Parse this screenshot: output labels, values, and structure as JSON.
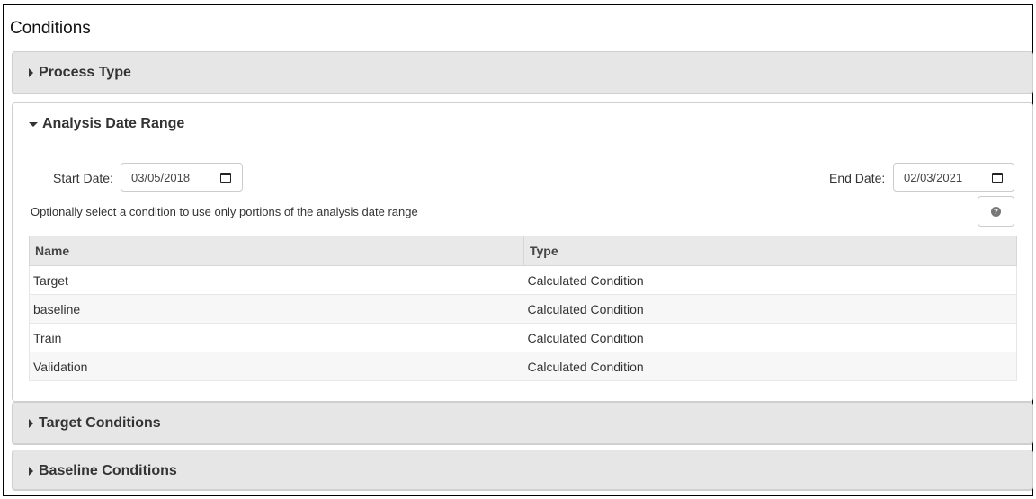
{
  "page": {
    "title": "Conditions"
  },
  "panels": {
    "process_type": {
      "label": "Process Type"
    },
    "analysis_date_range": {
      "label": "Analysis Date Range",
      "start_label": "Start Date:",
      "start_value": "03/05/2018",
      "end_label": "End Date:",
      "end_value": "02/03/2021",
      "hint": "Optionally select a condition to use only portions of the analysis date range",
      "help_icon_glyph": "?",
      "table": {
        "headers": [
          "Name",
          "Type"
        ],
        "rows": [
          [
            "Target",
            "Calculated Condition"
          ],
          [
            "baseline",
            "Calculated Condition"
          ],
          [
            "Train",
            "Calculated Condition"
          ],
          [
            "Validation",
            "Calculated Condition"
          ]
        ]
      }
    },
    "target_conditions": {
      "label": "Target Conditions"
    },
    "baseline_conditions": {
      "label": "Baseline Conditions"
    }
  }
}
